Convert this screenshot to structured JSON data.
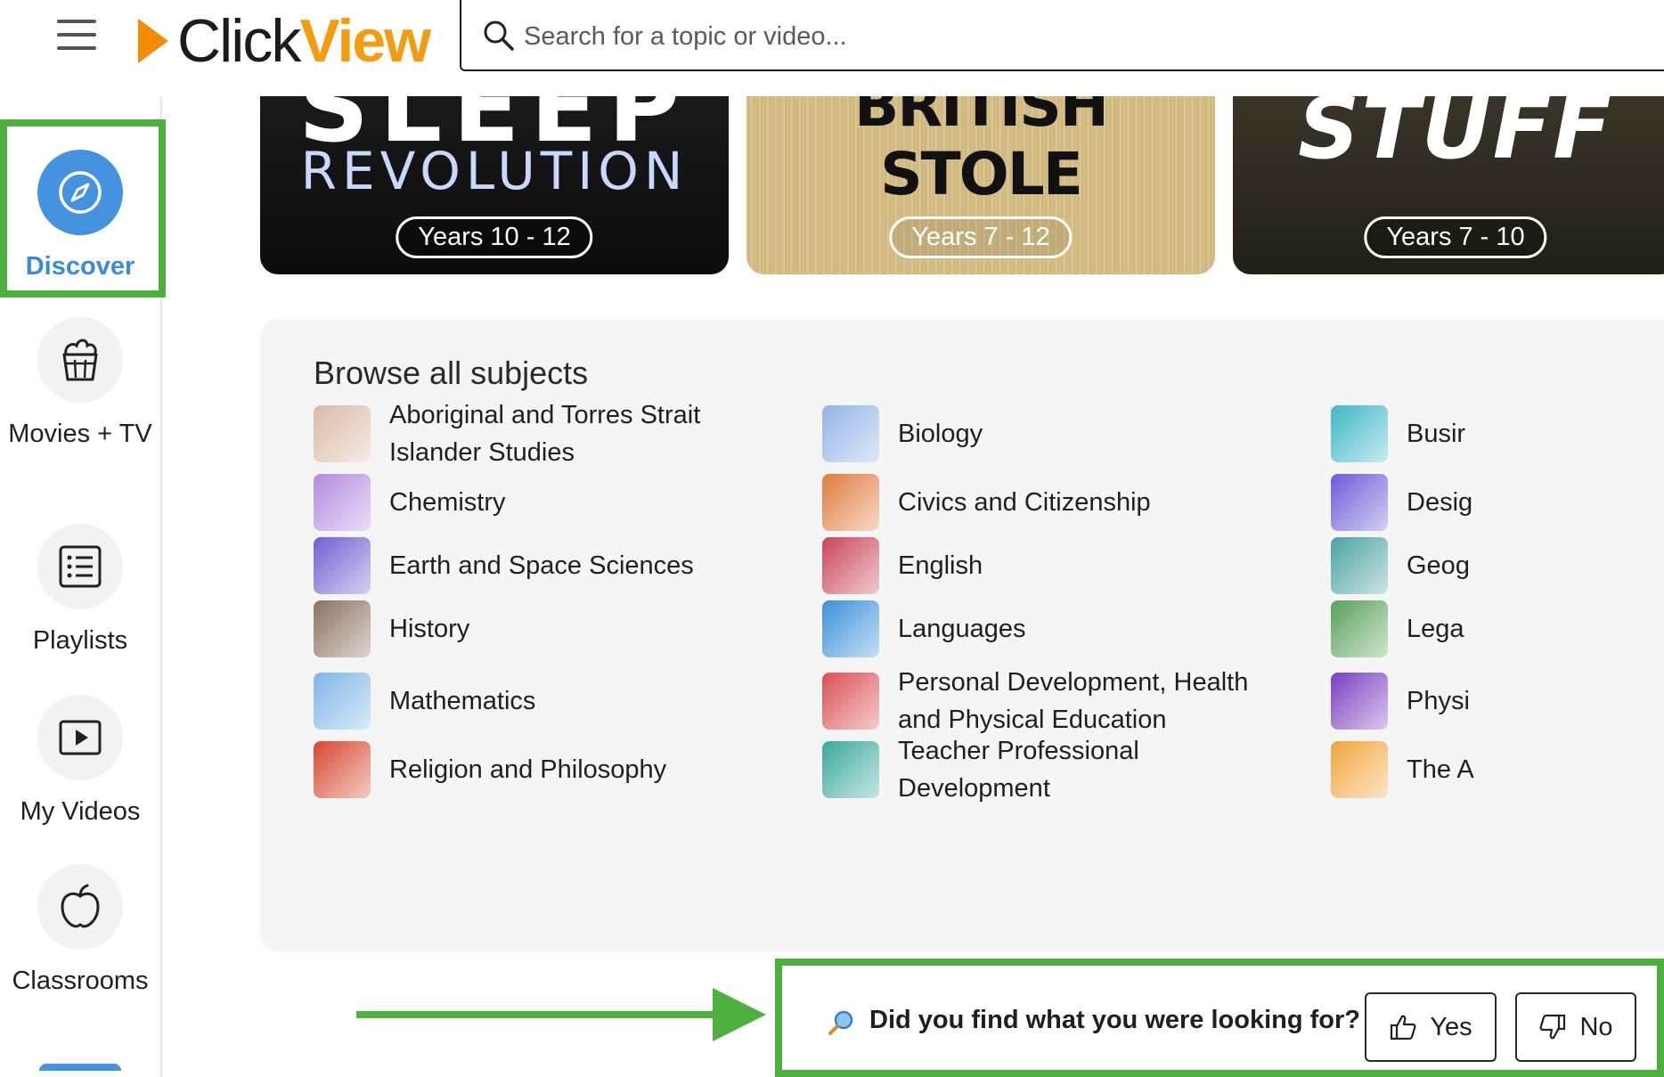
{
  "header": {
    "logo_click": "Click",
    "logo_view": "View",
    "search_placeholder": "Search for a topic or video..."
  },
  "sidebar": {
    "items": [
      {
        "label": "Discover",
        "icon": "compass-icon",
        "active": true
      },
      {
        "label": "Movies + TV",
        "icon": "popcorn-icon"
      },
      {
        "label": "Playlists",
        "icon": "list-icon"
      },
      {
        "label": "My Videos",
        "icon": "play-icon"
      },
      {
        "label": "Classrooms",
        "icon": "apple-icon"
      }
    ]
  },
  "cards": [
    {
      "title_top": "SLEEP",
      "title": "REVOLUTION",
      "years": "Years 10 - 12"
    },
    {
      "title_top": "BRITISH STOLE",
      "years": "Years 7 - 12"
    },
    {
      "title_top": "STUFF",
      "years": "Years 7 - 10"
    }
  ],
  "browse": {
    "title": "Browse all subjects",
    "subjects": [
      {
        "label": "Aboriginal and Torres Strait Islander Studies",
        "color": "#d9b9a6"
      },
      {
        "label": "Biology",
        "color": "#8fb3e6"
      },
      {
        "label": "Busir",
        "color": "#3fb6c6"
      },
      {
        "label": "Chemistry",
        "color": "#b28ae0"
      },
      {
        "label": "Civics and Citizenship",
        "color": "#e07a3f"
      },
      {
        "label": "Desig",
        "color": "#6a5bd6"
      },
      {
        "label": "Earth and Space Sciences",
        "color": "#6e5fd0"
      },
      {
        "label": "English",
        "color": "#c9455a"
      },
      {
        "label": "Geog",
        "color": "#4aa3a0"
      },
      {
        "label": "History",
        "color": "#8a7060"
      },
      {
        "label": "Languages",
        "color": "#3c8fd8"
      },
      {
        "label": "Lega",
        "color": "#5aa05a"
      },
      {
        "label": "Mathematics",
        "color": "#7fb6e8"
      },
      {
        "label": "Personal Development, Health and Physical Education",
        "color": "#d94f52"
      },
      {
        "label": "Physi",
        "color": "#7a3fc0"
      },
      {
        "label": "Religion and Philosophy",
        "color": "#d6482f"
      },
      {
        "label": "Teacher Professional Development",
        "color": "#3aa89a"
      },
      {
        "label": "The A",
        "color": "#f0a43a"
      }
    ]
  },
  "feedback": {
    "question": "Did you find what you were looking for?",
    "yes_label": "Yes",
    "no_label": "No"
  },
  "colors": {
    "brand_orange": "#f39c12",
    "active_blue": "#4592e0",
    "highlight_green": "#4caf3e"
  }
}
